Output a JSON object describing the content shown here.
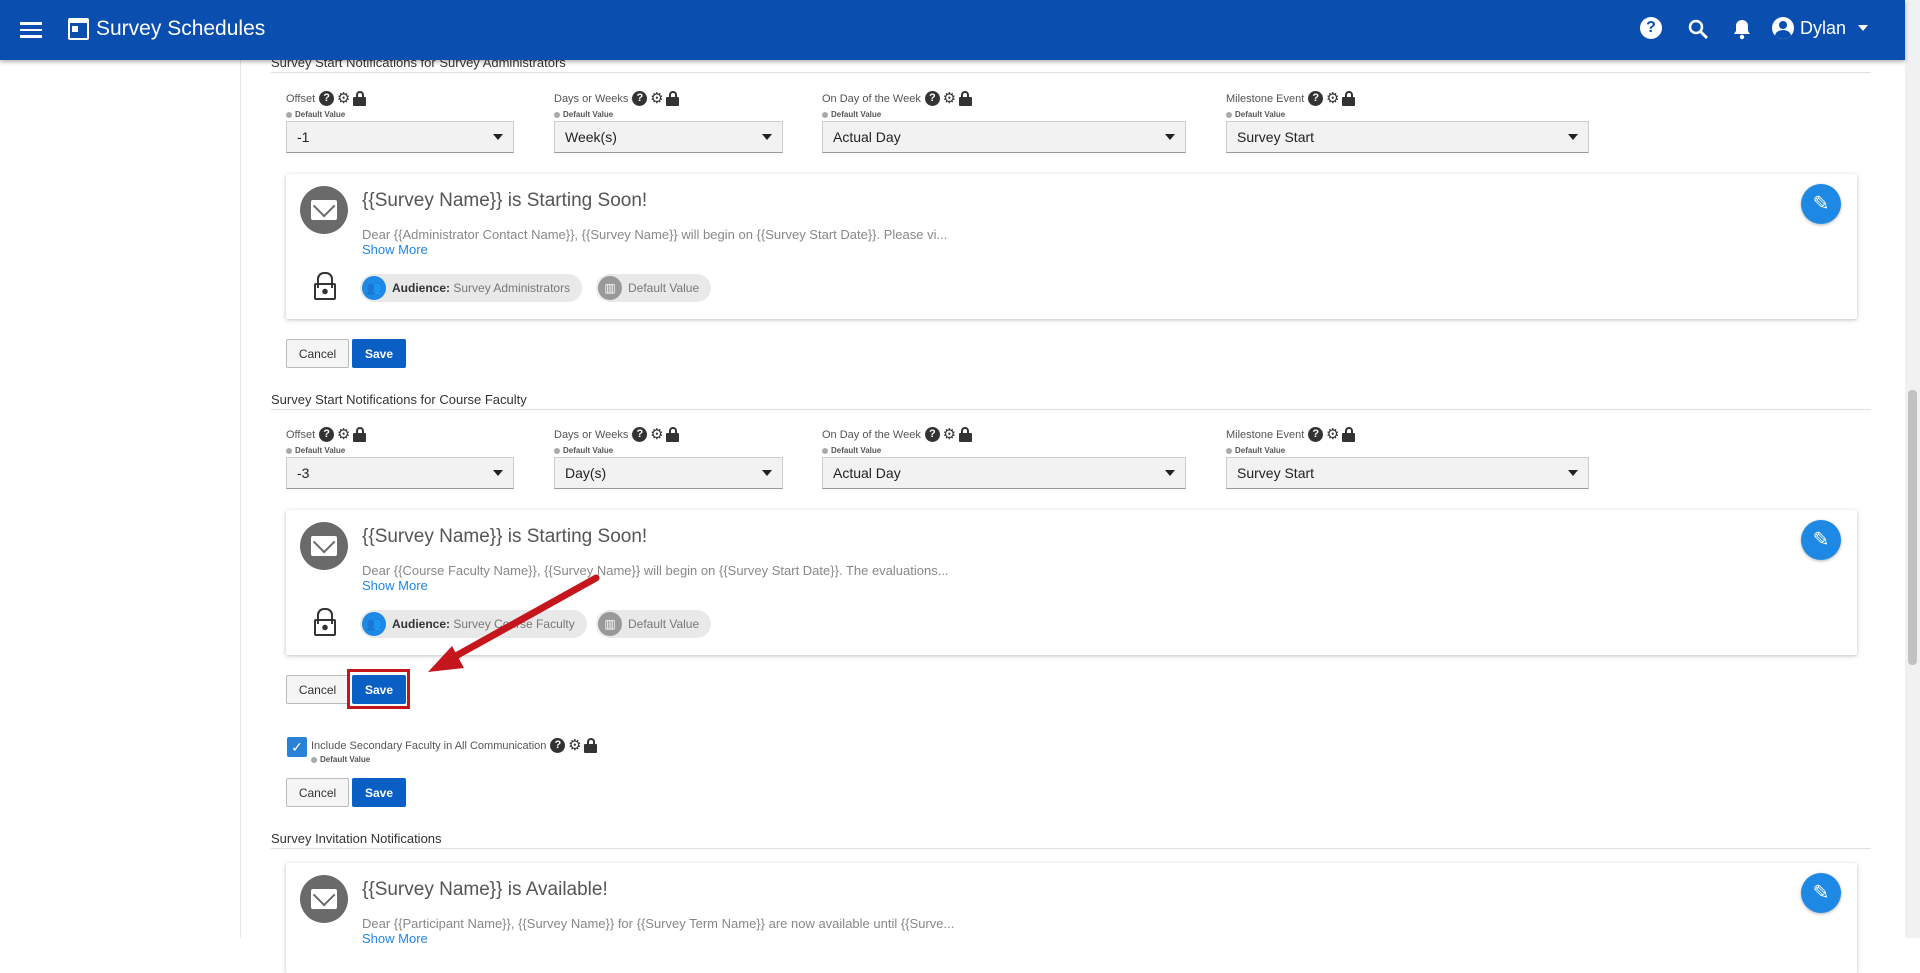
{
  "appbar": {
    "title": "Survey Schedules",
    "user": "Dylan"
  },
  "sections": [
    {
      "title": "Survey Start Notifications for Survey Administrators",
      "offset": {
        "label": "Offset",
        "value": "-1"
      },
      "days_weeks": {
        "label": "Days or Weeks",
        "value": "Week(s)"
      },
      "day_of_week": {
        "label": "On Day of the Week",
        "value": "Actual Day"
      },
      "milestone": {
        "label": "Milestone Event",
        "value": "Survey Start"
      },
      "default_value": "Default Value",
      "card": {
        "subject": "{{Survey Name}} is Starting Soon!",
        "body": "Dear {{Administrator Contact Name}}, {{Survey Name}} will begin on {{Survey Start Date}}. Please vi...",
        "show_more": "Show More",
        "audience_label": "Audience:",
        "audience": "Survey Administrators",
        "default_chip": "Default Value"
      },
      "cancel": "Cancel",
      "save": "Save"
    },
    {
      "title": "Survey Start Notifications for Course Faculty",
      "offset": {
        "label": "Offset",
        "value": "-3"
      },
      "days_weeks": {
        "label": "Days or Weeks",
        "value": "Day(s)"
      },
      "day_of_week": {
        "label": "On Day of the Week",
        "value": "Actual Day"
      },
      "milestone": {
        "label": "Milestone Event",
        "value": "Survey Start"
      },
      "default_value": "Default Value",
      "card": {
        "subject": "{{Survey Name}} is Starting Soon!",
        "body": "Dear {{Course Faculty Name}}, {{Survey Name}} will begin on {{Survey Start Date}}. The evaluations...",
        "show_more": "Show More",
        "audience_label": "Audience:",
        "audience": "Survey Course Faculty",
        "default_chip": "Default Value"
      },
      "cancel": "Cancel",
      "save": "Save"
    }
  ],
  "secondary": {
    "label": "Include Secondary Faculty in All Communication",
    "default_value": "Default Value",
    "cancel": "Cancel",
    "save": "Save"
  },
  "invitation": {
    "title": "Survey Invitation Notifications",
    "subject": "{{Survey Name}} is Available!",
    "body": "Dear {{Participant Name}}, {{Survey Name}} for {{Survey Term Name}} are now available until {{Surve...",
    "show_more": "Show More"
  },
  "colors": {
    "appbar": "#0a4fb0",
    "primary_button": "#0a5fc5",
    "edit_fab": "#1e88e5",
    "highlight": "#c4161c"
  }
}
